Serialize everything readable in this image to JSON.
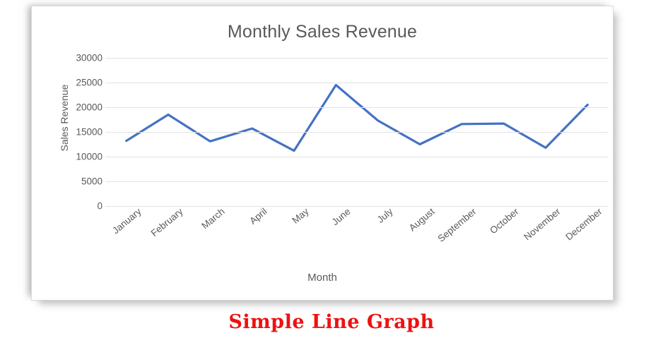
{
  "caption": "Simple Line Graph",
  "caption_color": "#ee1111",
  "frame": {
    "background": "#ffffff",
    "border_color": "#d9d9d9"
  },
  "chart_data": {
    "type": "line",
    "title": "Monthly Sales Revenue",
    "xlabel": "Month",
    "ylabel": "Sales Revenue",
    "categories": [
      "January",
      "February",
      "March",
      "April",
      "May",
      "June",
      "July",
      "August",
      "September",
      "October",
      "November",
      "December"
    ],
    "values": [
      13200,
      18500,
      13100,
      15700,
      11200,
      24500,
      17300,
      12500,
      16600,
      16700,
      11800,
      20500
    ],
    "ylim": [
      0,
      30000
    ],
    "ytick_labels": [
      "30000",
      "25000",
      "20000",
      "15000",
      "10000",
      "5000",
      "0"
    ],
    "ytick_values": [
      30000,
      25000,
      20000,
      15000,
      10000,
      5000,
      0
    ],
    "grid": true,
    "legend": false,
    "series_color": "#4472C4",
    "series_width": 3.2,
    "markers": false,
    "xtick_rotation": -40,
    "text_color": "#595959"
  }
}
